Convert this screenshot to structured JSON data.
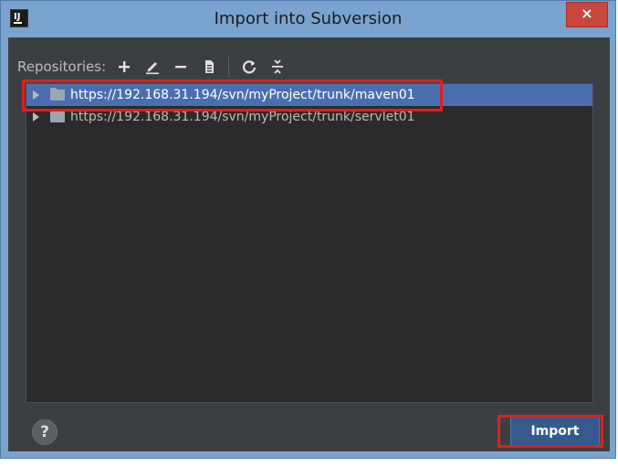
{
  "window": {
    "title": "Import into Subversion",
    "app_icon_text": "IJ",
    "close_glyph": "×"
  },
  "toolbar": {
    "label": "Repositories:",
    "icons": [
      "add-icon",
      "edit-icon",
      "remove-icon",
      "browse-icon",
      "refresh-icon",
      "collapse-icon"
    ]
  },
  "repositories": [
    {
      "url": "https://192.168.31.194/svn/myProject/trunk/maven01",
      "selected": true
    },
    {
      "url": "https://192.168.31.194/svn/myProject/trunk/servlet01",
      "selected": false
    }
  ],
  "buttons": {
    "help_label": "?",
    "import_label": "Import"
  },
  "colors": {
    "titlebar": "#7aa4cf",
    "panel": "#3c3f41",
    "tree_bg": "#2b2b2b",
    "selection": "#4b6eaf",
    "close": "#c9473d",
    "annotation": "#e02020"
  }
}
